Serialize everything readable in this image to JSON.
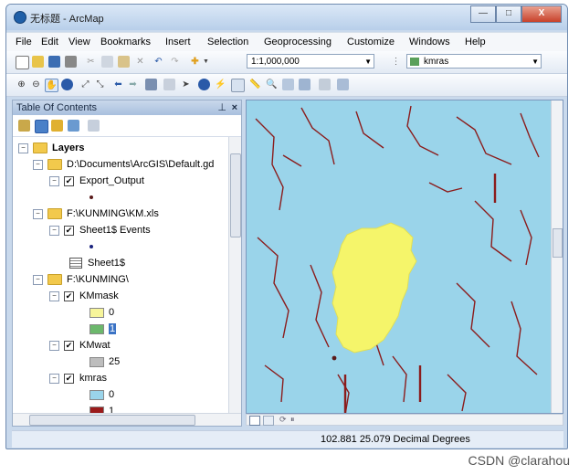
{
  "window": {
    "title": "无标题 - ArcMap",
    "buttons": [
      "—",
      "□",
      "X"
    ]
  },
  "menu": [
    "File",
    "Edit",
    "View",
    "Bookmarks",
    "Insert",
    "Selection",
    "Geoprocessing",
    "Customize",
    "Windows",
    "Help"
  ],
  "toolbar": {
    "scale": "1:1,000,000",
    "target_layer": "kmras"
  },
  "toc": {
    "title": "Table Of Contents",
    "root": "Layers",
    "items": [
      {
        "label": "D:\\Documents\\ArcGIS\\Default.gd"
      },
      {
        "label": "Export_Output"
      },
      {
        "label": "F:\\KUNMING\\KM.xls"
      },
      {
        "label": "Sheet1$ Events"
      },
      {
        "label": "Sheet1$"
      },
      {
        "label": "F:\\KUNMING\\"
      },
      {
        "label": "KMmask"
      },
      {
        "label": "0"
      },
      {
        "label": "1"
      },
      {
        "label": "KMwat"
      },
      {
        "label": "25"
      },
      {
        "label": "kmras"
      },
      {
        "label": "0"
      },
      {
        "label": "1"
      }
    ]
  },
  "status": {
    "coordinates": "102.881  25.079 Decimal Degrees"
  },
  "watermark": "CSDN @clarahou",
  "colors": {
    "water": "#9ad4ea",
    "mask": "#f5f56a",
    "stream": "#8b1c1c"
  }
}
